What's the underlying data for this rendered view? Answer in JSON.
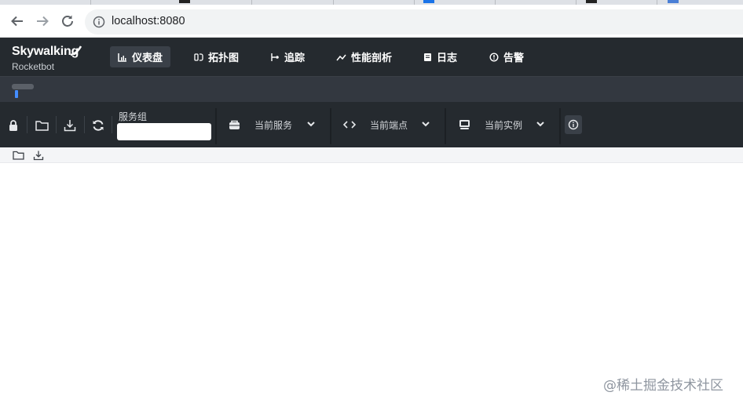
{
  "browser": {
    "url": "localhost:8080"
  },
  "header": {
    "logo_title": "Skywalking",
    "logo_subtitle": "Rocketbot",
    "nav": [
      {
        "label": "仪表盘",
        "icon": "dashboard-icon",
        "active": true
      },
      {
        "label": "拓扑图",
        "icon": "topology-icon",
        "active": false
      },
      {
        "label": "追踪",
        "icon": "trace-icon",
        "active": false
      },
      {
        "label": "性能剖析",
        "icon": "profile-icon",
        "active": false
      },
      {
        "label": "日志",
        "icon": "log-icon",
        "active": false
      },
      {
        "label": "告警",
        "icon": "alarm-icon",
        "active": false
      }
    ]
  },
  "toolbar": {
    "service_group_label": "服务组",
    "service_group_value": "",
    "current_service": "当前服务",
    "current_endpoint": "当前端点",
    "current_instance": "当前实例"
  },
  "colors": {
    "header_bg": "#252a2f",
    "subheader_bg": "#333840",
    "accent_blue": "#448dfe",
    "content_bar_bg": "#f4f5f7"
  },
  "watermark": "@稀土掘金技术社区"
}
